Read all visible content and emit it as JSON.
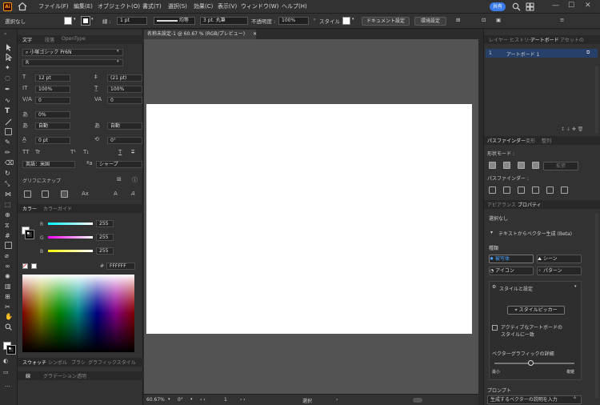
{
  "app": {
    "logo_text": "Ai"
  },
  "menu": [
    "ファイル(F)",
    "編集(E)",
    "オブジェクト(O)",
    "書式(T)",
    "選択(S)",
    "効果(C)",
    "表示(V)",
    "ウィンドウ(W)",
    "ヘルプ(H)"
  ],
  "header": {
    "share_label": "共有",
    "minimize": "—",
    "maximize": "☐",
    "close": "✕"
  },
  "control_bar": {
    "selection": "選択なし",
    "stroke_label": "線 :",
    "stroke_value": "1 pt",
    "profile": "均等",
    "brush": "3 pt. 丸筆",
    "opacity_label": "不透明度 :",
    "opacity_value": "100%",
    "style_label": "スタイル :",
    "doc_settings": "ドキュメント設定",
    "prefs": "環境設定"
  },
  "character_panel": {
    "tabs": [
      "文字",
      "段落",
      "OpenType"
    ],
    "font_family": "小塚ゴシック Pr6N",
    "font_style": "R",
    "font_size": "12 pt",
    "leading": "(21 pt)",
    "vertical_scale": "100%",
    "horizontal_scale": "100%",
    "kerning": "0",
    "tracking": "0",
    "tsume": "0%",
    "aki_left": "自動",
    "aki_right": "自動",
    "baseline": "0 pt",
    "rotation": "0°",
    "language": "英語：米国",
    "antialias": "シャープ",
    "snap_label": "グリフにスナップ"
  },
  "color_panel": {
    "tabs": [
      "カラー",
      "カラーガイド"
    ],
    "r_label": "R",
    "r_value": "255",
    "g_label": "G",
    "g_value": "255",
    "b_label": "B",
    "b_value": "255",
    "hex": "FFFFFF"
  },
  "bottom_tabs_1": [
    "スウォッチ",
    "シンボル",
    "ブラシ",
    "グラフィックスタイル"
  ],
  "bottom_tabs_2": [
    "線",
    "グラデーション",
    "透明"
  ],
  "document": {
    "tab_title": "名称未設定-1 @ 60.67 % (RGB/プレビュー)",
    "close": "✕"
  },
  "status": {
    "zoom": "60.67%",
    "rotation": "0°",
    "artboard_num": "1",
    "tool": "選択"
  },
  "layers_panel": {
    "tabs": [
      "レイヤー",
      "ヒストリー",
      "アートボード",
      "アセットの"
    ],
    "artboard_index": "1",
    "artboard_name": "アートボード 1"
  },
  "pathfinder_panel": {
    "tabs": [
      "パスファインダー",
      "変形",
      "整列"
    ],
    "shape_mode": "形状モード :",
    "expand": "拡張",
    "pathfinder_label": "パスファインダー :"
  },
  "properties_panel": {
    "tabs": [
      "アピアランス",
      "プロパティ"
    ],
    "selection": "選択なし",
    "vector_gen": "テキストからベクター生成 (Beta)",
    "type_label": "種類",
    "types": [
      "被写体",
      "シーン",
      "アイコン",
      "パターン"
    ],
    "style_settings": "スタイルと設定",
    "style_picker": "スタイルピッカー",
    "match_artboard": "アクティブなアートボードの",
    "match_artboard_2": "スタイルに一致",
    "detail_label": "ベクターグラフィックの詳細",
    "detail_min": "最小",
    "detail_max": "複雑",
    "detail_level": 0.45,
    "prompt_label": "プロンプト",
    "prompt_placeholder": "生成するベクターの説明を入力"
  }
}
